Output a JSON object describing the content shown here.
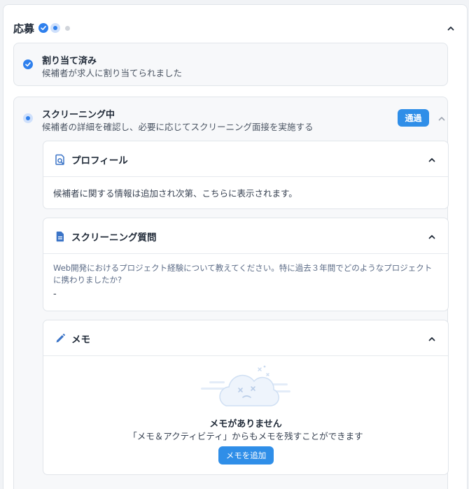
{
  "header": {
    "title": "応募"
  },
  "steps": [
    {
      "title": "割り当て済み",
      "description": "候補者が求人に割り当てられました"
    },
    {
      "title": "スクリーニング中",
      "description": "候補者の詳細を確認し、必要に応じてスクリーニング面接を実施する",
      "action_label": "通過"
    }
  ],
  "panels": {
    "profile": {
      "title": "プロフィール",
      "body": "候補者に関する情報は追加され次第、こちらに表示されます。"
    },
    "screening": {
      "title": "スクリーニング質問",
      "question": "Web開発におけるプロジェクト経験について教えてください。特に過去３年間でどのようなプロジェクトに携わりましたか?",
      "answer": "-"
    },
    "memo": {
      "title": "メモ",
      "empty_title": "メモがありません",
      "empty_desc": "「メモ＆アクティビティ」からもメモを残すことができます",
      "add_label": "メモを追加"
    }
  },
  "colors": {
    "accent": "#2f8ee8",
    "step_done": "#2f80ed",
    "step_current_ring": "#cfe0fb",
    "step_todo": "#d1d5db"
  },
  "icons": {
    "check": "check-icon",
    "profile": "profile-search-icon",
    "document": "document-icon",
    "memo": "pencil-icon",
    "collapse": "chevron-up-icon",
    "empty": "empty-cloud-illustration"
  }
}
